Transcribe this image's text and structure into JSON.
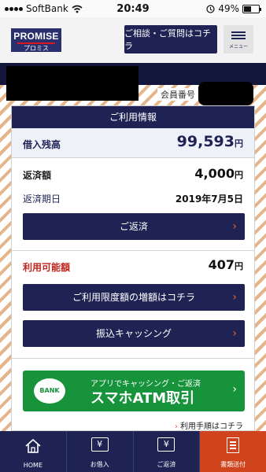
{
  "status": {
    "carrier": "SoftBank",
    "time": "20:49",
    "battery": "49%"
  },
  "header": {
    "logo_en": "PROMISE",
    "logo_jp": "プロミス",
    "consult_label": "ご相談・ご質問はコチラ",
    "menu_label": "メニュー"
  },
  "member": {
    "number_label": "会員番号"
  },
  "card": {
    "title": "ご利用情報",
    "balance": {
      "label": "借入残高",
      "value": "99,593",
      "unit": "円"
    },
    "repay_amount": {
      "label": "返済額",
      "value": "4,000",
      "unit": "円"
    },
    "due_date": {
      "label": "返済期日",
      "value": "2019年7月5日"
    },
    "repay_button": "ご返済",
    "available": {
      "label": "利用可能額",
      "value": "407",
      "unit": "円"
    },
    "increase_button": "ご利用限度額の増額はコチラ",
    "transfer_button": "振込キャッシング",
    "atm": {
      "bank": "BANK",
      "sub": "アプリでキャッシング・ご返済",
      "main": "スマホATM取引"
    },
    "procedure_link": "利用手順はコチラ"
  },
  "tabbar": [
    {
      "label": "HOME"
    },
    {
      "label": "お借入"
    },
    {
      "label": "ご返済"
    },
    {
      "label": "書類送付"
    }
  ],
  "colors": {
    "navy": "#1e2354",
    "green": "#16933b",
    "orange": "#d0441d",
    "red": "#c0261e"
  },
  "icons": [
    "wifi-icon",
    "alarm-icon",
    "battery-icon",
    "hamburger-icon",
    "chevron-right-icon",
    "home-icon",
    "yen-withdraw-icon",
    "yen-repay-icon",
    "document-icon",
    "seven-bank-logo"
  ]
}
